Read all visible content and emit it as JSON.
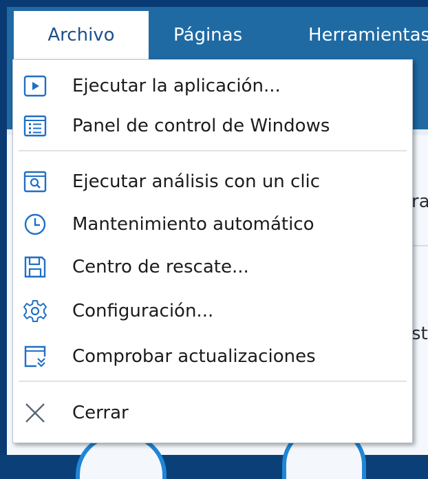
{
  "menubar": {
    "items": [
      {
        "label": "Archivo"
      },
      {
        "label": "Páginas"
      },
      {
        "label": "Herramientas"
      }
    ]
  },
  "background": {
    "fragment_1": "ra",
    "fragment_2": "st"
  },
  "dropdown": {
    "items": [
      {
        "label": "Ejecutar la aplicación...",
        "icon": "play-window-icon"
      },
      {
        "label": "Panel de control de Windows",
        "icon": "control-panel-icon"
      },
      {
        "label": "Ejecutar análisis con un clic",
        "icon": "scan-window-icon"
      },
      {
        "label": "Mantenimiento automático",
        "icon": "clock-icon"
      },
      {
        "label": "Centro de rescate...",
        "icon": "floppy-disk-icon"
      },
      {
        "label": "Configuración...",
        "icon": "gear-icon"
      },
      {
        "label": "Comprobar actualizaciones",
        "icon": "update-check-icon"
      },
      {
        "label": "Cerrar",
        "icon": "close-icon"
      }
    ]
  },
  "colors": {
    "accent": "#1f86d6",
    "menubar_bg": "#1f6aa3",
    "icon_blue": "#1f6fc5"
  }
}
